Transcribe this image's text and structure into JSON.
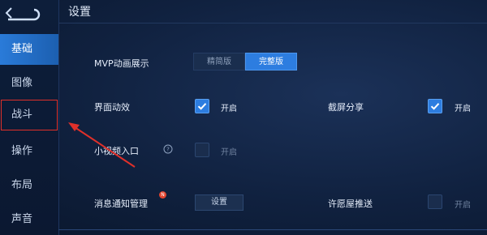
{
  "page": {
    "title": "设置"
  },
  "sidebar": {
    "items": [
      {
        "label": "基础",
        "active": true
      },
      {
        "label": "图像",
        "active": false
      },
      {
        "label": "战斗",
        "active": false,
        "highlighted": true
      },
      {
        "label": "操作",
        "active": false
      },
      {
        "label": "布局",
        "active": false
      },
      {
        "label": "声音",
        "active": false
      }
    ]
  },
  "settings": {
    "mvp_animation": {
      "label": "MVP动画展示",
      "options": [
        "精简版",
        "完整版"
      ],
      "selected": "完整版"
    },
    "ui_animation": {
      "label": "界面动效",
      "checked": true,
      "state_label": "开启"
    },
    "screenshot_share": {
      "label": "截屏分享",
      "checked": true,
      "state_label": "开启"
    },
    "mini_video_entry": {
      "label": "小视频入口",
      "checked": false,
      "state_label": "开启",
      "help_icon": "help-circle-icon"
    },
    "notification_mgmt": {
      "label": "消息通知管理",
      "button_label": "设置",
      "badge": "new-badge"
    },
    "wish_tree_push": {
      "label": "许愿屋推送",
      "checked": false,
      "state_label": "开启"
    }
  },
  "colors": {
    "accent": "#2d7de0",
    "highlight_outline": "#e0302a",
    "background": "#10213f"
  }
}
